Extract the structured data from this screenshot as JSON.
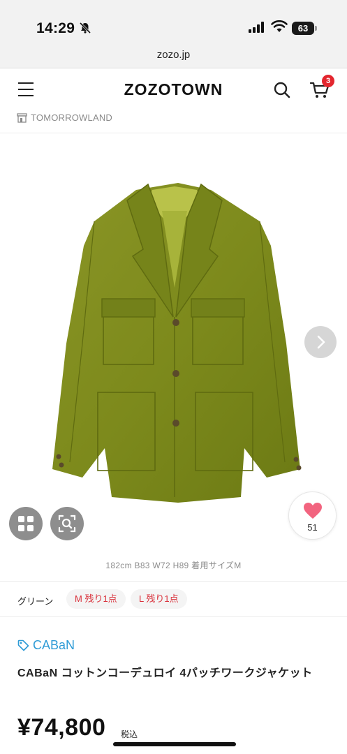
{
  "status_bar": {
    "time": "14:29",
    "battery": "63"
  },
  "browser": {
    "url": "zozo.jp"
  },
  "header": {
    "logo": "ZOZOTOWN",
    "cart_count": "3"
  },
  "shop": {
    "name": "TOMORROWLAND"
  },
  "gallery": {
    "favorite_count": "51",
    "favorite_color": "#f2647f"
  },
  "model_info": "182cm B83 W72 H89 着用サイズM",
  "variant": {
    "color": "グリーン",
    "sizes": [
      {
        "label": "M 残り1点"
      },
      {
        "label": "L 残り1点"
      }
    ]
  },
  "product": {
    "brand": "CABaN",
    "brand_color": "#2e9bd6",
    "name": "CABaN コットンコーデュロイ 4パッチワークジャケット",
    "price": "¥74,800",
    "tax_label": "税込"
  },
  "icons": [
    "bell-muted-icon",
    "signal-icon",
    "wifi-icon",
    "menu-icon",
    "search-icon",
    "cart-icon",
    "shop-icon",
    "chevron-right-icon",
    "grid-icon",
    "image-search-icon",
    "heart-icon",
    "tag-icon"
  ]
}
